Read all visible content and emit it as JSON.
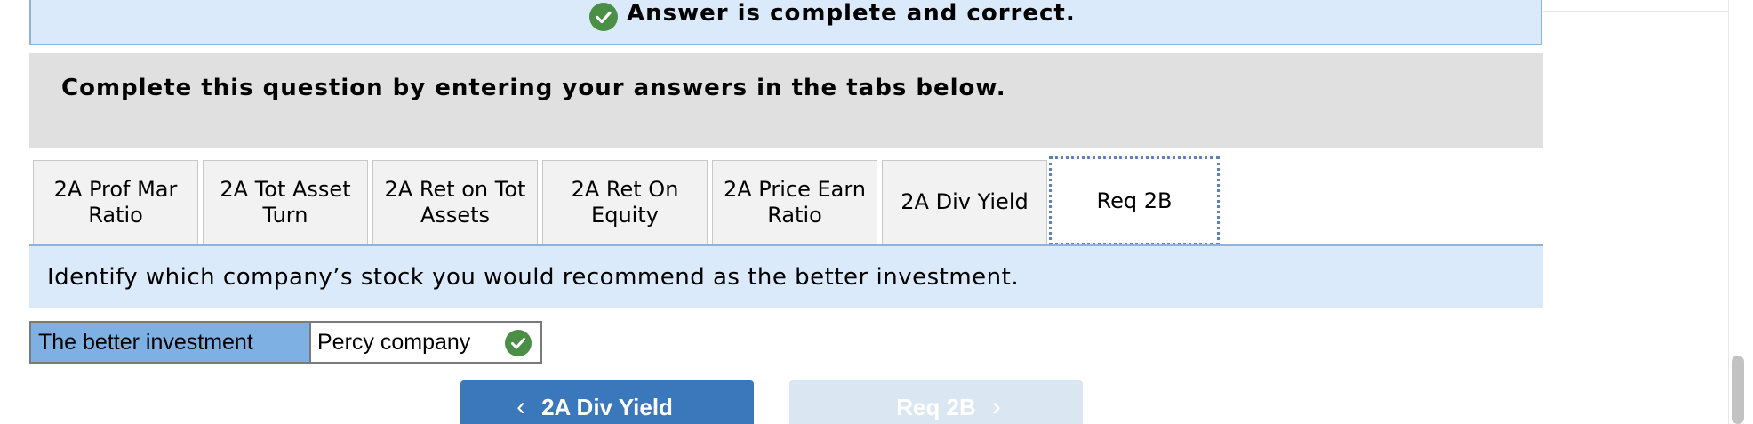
{
  "status": {
    "message": "Answer is complete and correct.",
    "icon": "check-circle-icon",
    "color": "#4a8f45"
  },
  "instruction": {
    "text": "Complete this question by entering your answers in the tabs below."
  },
  "tabs": [
    {
      "label": "2A Prof Mar Ratio",
      "active": false
    },
    {
      "label": "2A Tot Asset Turn",
      "active": false
    },
    {
      "label": "2A Ret on Tot Assets",
      "active": false
    },
    {
      "label": "2A Ret On Equity",
      "active": false
    },
    {
      "label": "2A Price Earn Ratio",
      "active": false
    },
    {
      "label": "2A Div Yield",
      "active": false
    },
    {
      "label": "Req 2B",
      "active": true
    }
  ],
  "question": {
    "text": "Identify which company’s stock you would recommend as the better investment."
  },
  "answer": {
    "label": "The better investment",
    "value": "Percy company",
    "status_icon": "check-circle-icon"
  },
  "navigation": {
    "prev_label": "2A Div Yield",
    "prev_icon": "chevron-left-icon",
    "next_label": "Req 2B",
    "next_icon": "chevron-right-icon"
  },
  "colors": {
    "accent": "#3b77bb",
    "banner": "#dbeafb",
    "label_cell": "#7fb0e3",
    "success": "#4a8f45"
  }
}
